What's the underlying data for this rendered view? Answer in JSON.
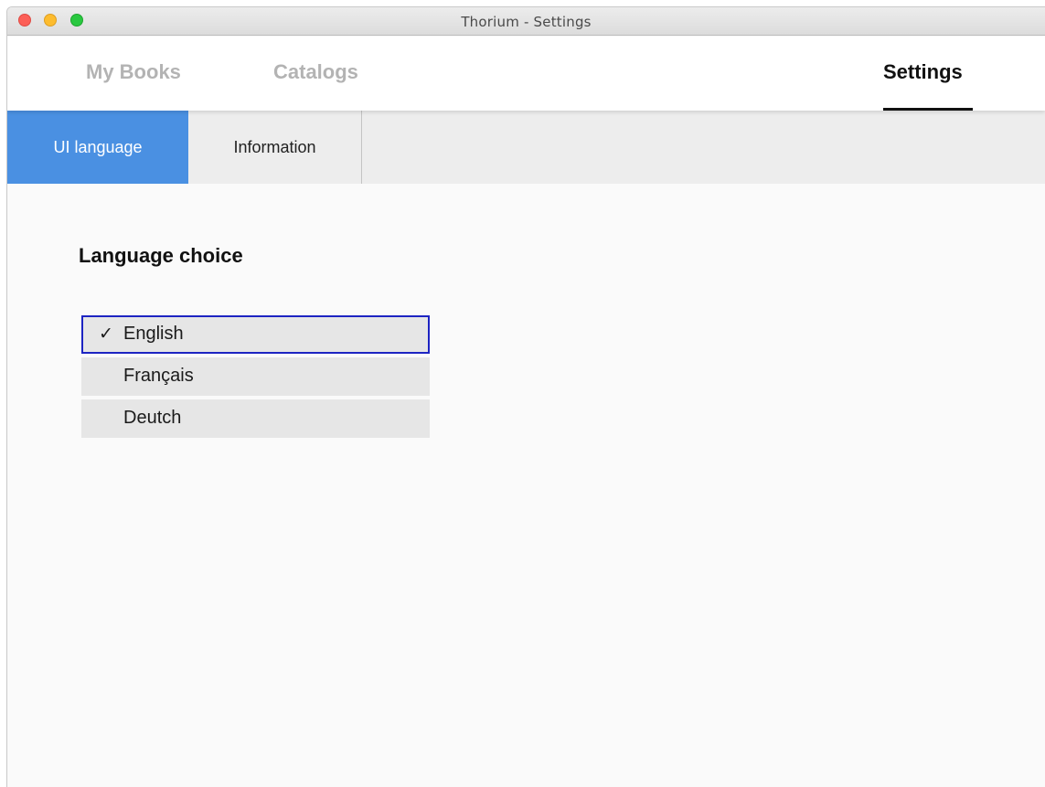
{
  "window": {
    "title": "Thorium - Settings"
  },
  "topnav": {
    "items": [
      {
        "label": "My Books",
        "active": false
      },
      {
        "label": "Catalogs",
        "active": false
      },
      {
        "label": "Settings",
        "active": true
      }
    ]
  },
  "subtabs": {
    "items": [
      {
        "label": "UI language",
        "active": true
      },
      {
        "label": "Information",
        "active": false
      }
    ]
  },
  "content": {
    "title": "Language choice",
    "languages": [
      {
        "label": "English",
        "selected": true,
        "icon": "check-icon"
      },
      {
        "label": "Français",
        "selected": false
      },
      {
        "label": "Deutch",
        "selected": false
      }
    ],
    "check_glyph": "✓"
  },
  "colors": {
    "accent": "#4a90e2",
    "selection_border": "#1d24c2",
    "nav_inactive": "#b3b3b3"
  }
}
